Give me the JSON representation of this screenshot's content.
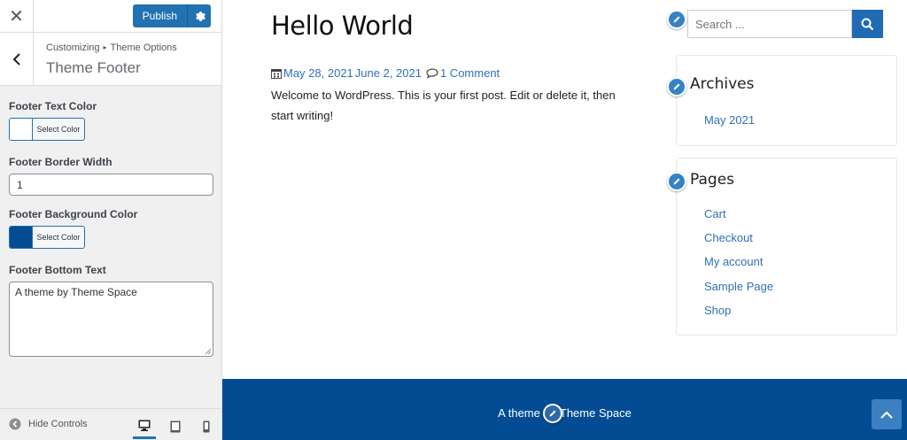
{
  "customizer": {
    "publish_label": "Publish",
    "breadcrumb": [
      "Customizing",
      "Theme Options"
    ],
    "section_title": "Theme Footer",
    "controls": {
      "footer_text_color": {
        "label": "Footer Text Color",
        "button": "Select Color",
        "color": "#ffffff"
      },
      "footer_border_width": {
        "label": "Footer Border Width",
        "value": "1"
      },
      "footer_background_color": {
        "label": "Footer Background Color",
        "button": "Select Color",
        "color": "#034c94"
      },
      "footer_bottom_text": {
        "label": "Footer Bottom Text",
        "value": "A theme by Theme Space"
      }
    },
    "footer": {
      "hide_controls_label": "Hide Controls",
      "devices": [
        "desktop-icon",
        "tablet-icon",
        "mobile-icon"
      ],
      "active_device": "desktop"
    }
  },
  "preview": {
    "post": {
      "title": "Hello World",
      "published_date": "May 28, 2021",
      "updated_date": "June 2, 2021",
      "comments": "1 Comment",
      "excerpt": "Welcome to WordPress. This is your first post. Edit or delete it, then start writing!"
    },
    "search": {
      "placeholder": "Search ..."
    },
    "archives": {
      "title": "Archives",
      "items": [
        "May 2021"
      ]
    },
    "pages": {
      "title": "Pages",
      "items": [
        "Cart",
        "Checkout",
        "My account",
        "Sample Page",
        "Shop"
      ]
    },
    "footer": {
      "text_before": "A theme",
      "text_after": "Theme Space",
      "background": "#034c94"
    }
  },
  "colors": {
    "accent": "#2271b1",
    "link": "#2f70b5",
    "footer_bg": "#034c94"
  }
}
